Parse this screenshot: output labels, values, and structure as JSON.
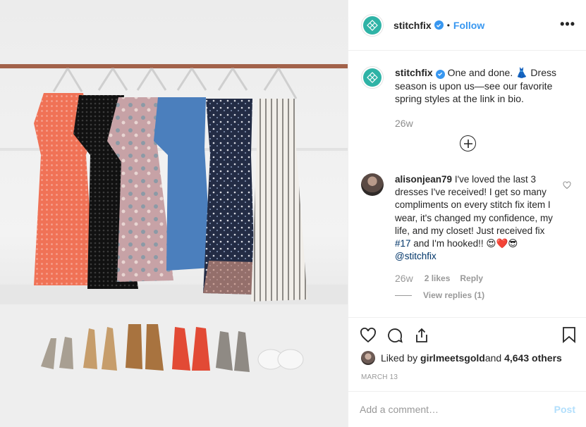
{
  "post": {
    "username": "stitchfix",
    "follow_label": "Follow",
    "dot": "•",
    "more_label": "•••",
    "caption": "One and done. 👗 Dress season is upon us—see our favorite spring styles at the link in bio.",
    "time": "26w",
    "load_more_label": "+"
  },
  "comment": {
    "username": "alisonjean79",
    "text": "I've loved the last 3 dresses I've received! I get so many compliments on every stitch fix item I wear, it's changed my confidence, my life, and my closet! Just received fix ",
    "hashtag": "#17",
    "text_after": " and I'm hooked!! 😍❤️😎 ",
    "mention": "@stitchfix",
    "time": "26w",
    "likes": "2 likes",
    "reply_label": "Reply",
    "view_replies": "View replies (1)"
  },
  "likes": {
    "prefix": "Liked by ",
    "user": "girlmeetsgold",
    "middle": " and ",
    "count": "4,643 others"
  },
  "date": "MARCH 13",
  "add_comment": {
    "placeholder": "Add a comment…",
    "post_label": "Post"
  },
  "colors": {
    "accent": "#3897f0",
    "brand": "#2fb3a6",
    "post_disabled": "#b2dffc",
    "link": "#003569"
  },
  "icons": [
    "stitchfix-logo-icon",
    "verified-badge-icon",
    "heart-icon",
    "comment-icon",
    "share-icon",
    "bookmark-icon",
    "add-circle-icon"
  ]
}
